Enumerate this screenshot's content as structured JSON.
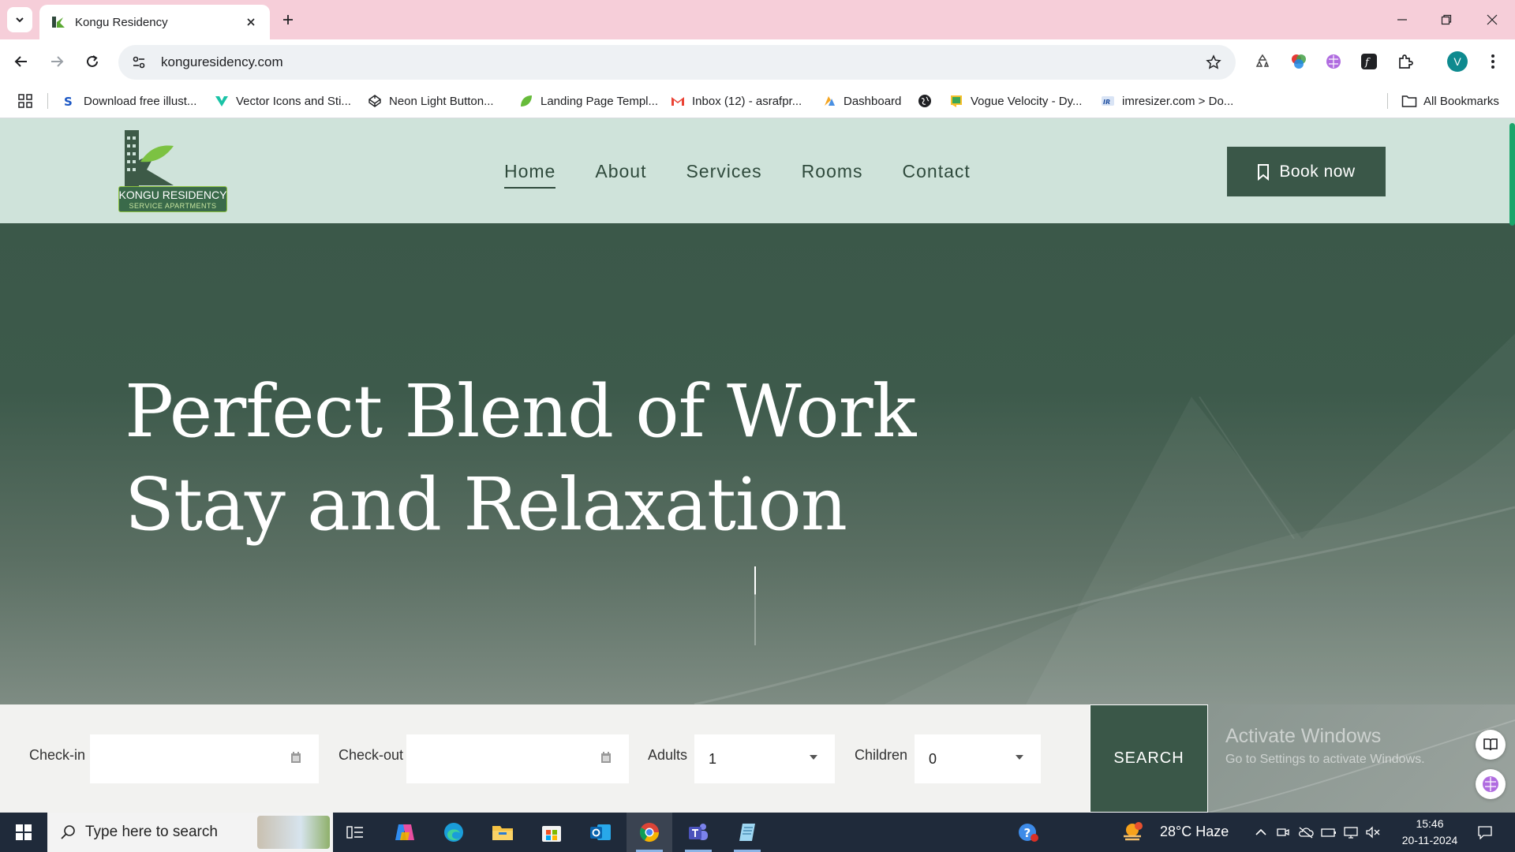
{
  "browser": {
    "tab_title": "Kongu Residency",
    "url": "konguresidency.com",
    "bookmarks": [
      "Download free illust...",
      "Vector Icons and Sti...",
      "Neon Light Button...",
      "Landing Page Templ...",
      "Inbox (12) - asrafpr...",
      "Dashboard",
      "",
      "Vogue Velocity - Dy...",
      "imresizer.com > Do..."
    ],
    "all_bookmarks": "All Bookmarks",
    "profile_initial": "V"
  },
  "site": {
    "logo": {
      "name": "KONGU RESIDENCY",
      "tagline": "SERVICE APARTMENTS"
    },
    "nav": [
      "Home",
      "About",
      "Services",
      "Rooms",
      "Contact"
    ],
    "active_nav": "Home",
    "book_now": "Book now",
    "hero_title_line1": "Perfect Blend of Work",
    "hero_title_line2": "Stay and Relaxation",
    "booking": {
      "checkin_label": "Check-in",
      "checkin_value": "",
      "checkout_label": "Check-out",
      "checkout_value": "",
      "adults_label": "Adults",
      "adults_value": "1",
      "children_label": "Children",
      "children_value": "0",
      "search": "SEARCH"
    },
    "watermark_title": "Activate Windows",
    "watermark_sub": "Go to Settings to activate Windows."
  },
  "taskbar": {
    "search_placeholder": "Type here to search",
    "weather": "28°C  Haze",
    "time": "15:46",
    "date": "20-11-2024"
  },
  "colors": {
    "brand_dark": "#3a5748",
    "header_bg": "#cfe3da",
    "tabstrip_bg": "#f6ced9"
  }
}
